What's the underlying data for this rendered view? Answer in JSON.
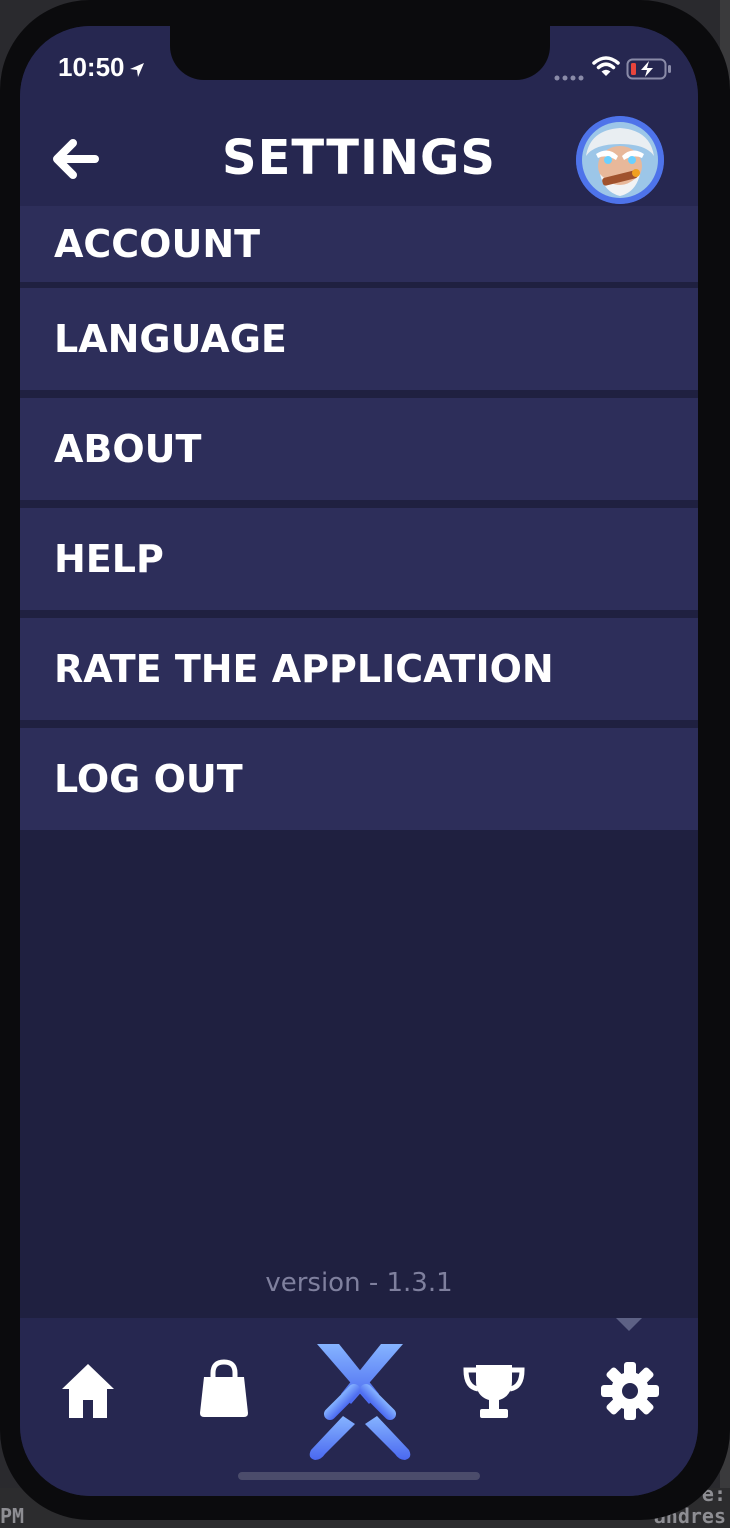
{
  "status_bar": {
    "time": "10:50"
  },
  "header": {
    "title": "SETTINGS"
  },
  "menu": {
    "items": [
      {
        "label": "ACCOUNT"
      },
      {
        "label": "LANGUAGE"
      },
      {
        "label": "ABOUT"
      },
      {
        "label": "HELP"
      },
      {
        "label": "RATE THE APPLICATION"
      },
      {
        "label": "LOG OUT"
      }
    ]
  },
  "footer": {
    "version": "version - 1.3.1"
  },
  "tabs": [
    {
      "icon": "home-icon"
    },
    {
      "icon": "shopping-bag-icon"
    },
    {
      "icon": "crossed-swords-icon"
    },
    {
      "icon": "trophy-icon"
    },
    {
      "icon": "gear-icon",
      "selected": true
    }
  ],
  "background": {
    "left_text": "PM",
    "right_text": "andres",
    "right_text_2": "e:"
  },
  "colors": {
    "header_bg": "#262750",
    "menu_item_bg": "#2d2e5a",
    "screen_bg": "#1f2040",
    "accent": "#4e73ea",
    "battery_low": "#e8453c"
  }
}
